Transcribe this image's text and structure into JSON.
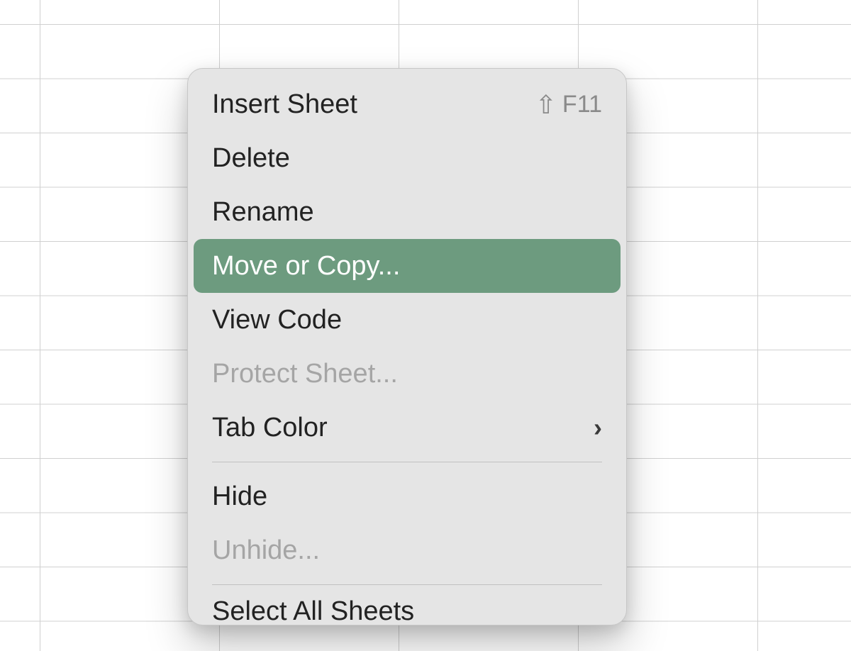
{
  "menu": {
    "items": [
      {
        "label": "Insert Sheet",
        "shortcut_key": "F11",
        "has_shift": true
      },
      {
        "label": "Delete"
      },
      {
        "label": "Rename"
      },
      {
        "label": "Move or Copy...",
        "selected": true
      },
      {
        "label": "View Code"
      },
      {
        "label": "Protect Sheet...",
        "disabled": true
      },
      {
        "label": "Tab Color",
        "submenu": true
      }
    ],
    "group2": [
      {
        "label": "Hide"
      },
      {
        "label": "Unhide...",
        "disabled": true
      }
    ],
    "group3": [
      {
        "label": "Select All Sheets"
      }
    ]
  },
  "colors": {
    "highlight": "#6d9b7f",
    "menu_bg": "#e5e5e5",
    "grid_line": "#d0d0d0"
  }
}
